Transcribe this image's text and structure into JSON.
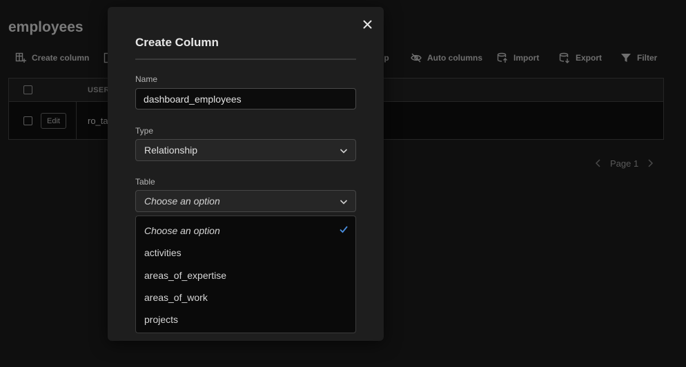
{
  "page": {
    "title": "employees"
  },
  "toolbar": [
    {
      "label": "Create column",
      "icon": "create-column-icon"
    },
    {
      "label": "ip",
      "icon": "relationship-icon"
    },
    {
      "label": "Auto columns",
      "icon": "eye-off-icon"
    },
    {
      "label": "Import",
      "icon": "import-icon"
    },
    {
      "label": "Export",
      "icon": "export-icon"
    },
    {
      "label": "Filter",
      "icon": "filter-icon"
    }
  ],
  "grid": {
    "column_header": "USER_",
    "edit_label": "Edit",
    "row_value": "ro_ta"
  },
  "pagination": {
    "label": "Page 1"
  },
  "modal": {
    "title": "Create Column",
    "name_label": "Name",
    "name_value": "dashboard_employees",
    "type_label": "Type",
    "type_value": "Relationship",
    "table_label": "Table",
    "table_value": "Choose an option",
    "options": [
      "Choose an option",
      "activities",
      "areas_of_expertise",
      "areas_of_work",
      "projects"
    ],
    "selected_index": 0
  },
  "colors": {
    "accent": "#4a8fe0",
    "modal_bg": "#1e1e1e",
    "page_bg": "#0f0f0f"
  }
}
